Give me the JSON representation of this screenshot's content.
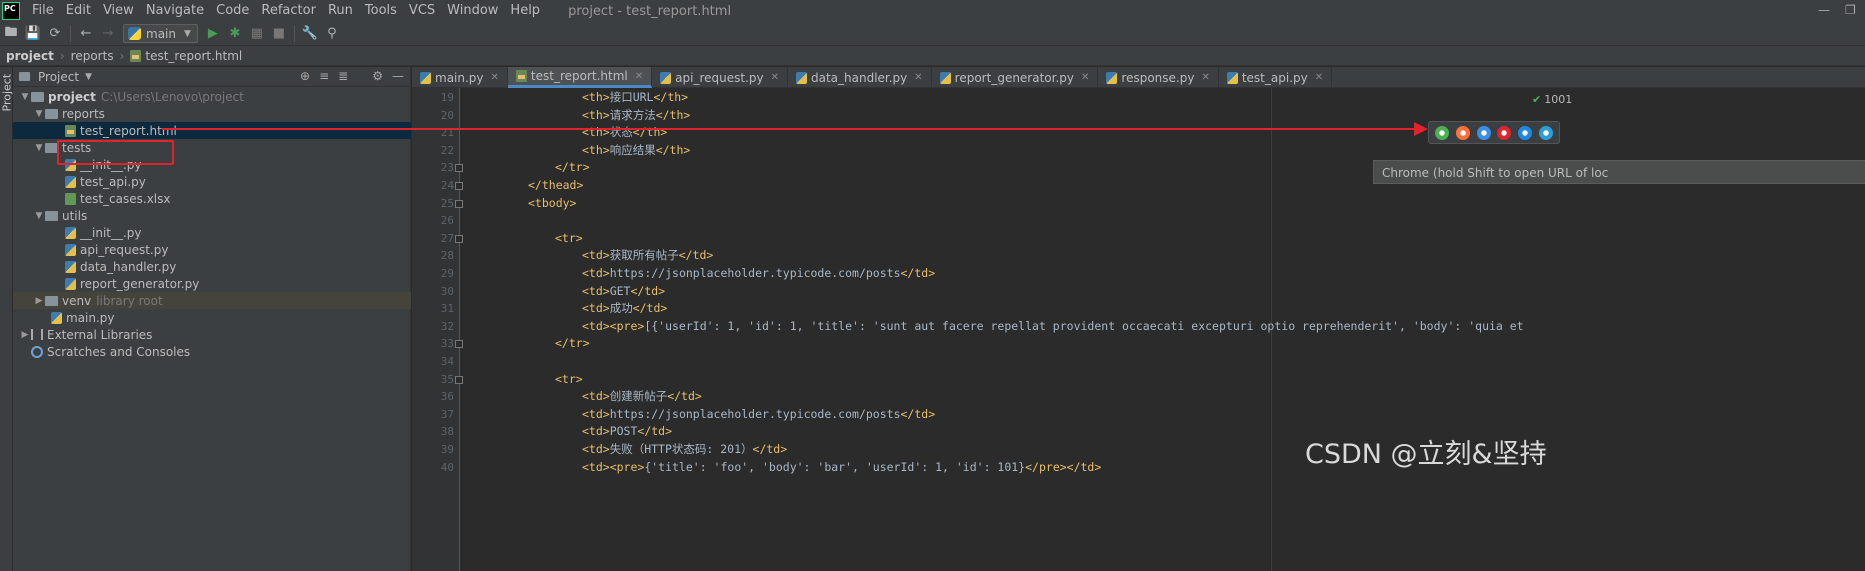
{
  "menubar": {
    "logo": "PC",
    "items": [
      "File",
      "Edit",
      "View",
      "Navigate",
      "Code",
      "Refactor",
      "Run",
      "Tools",
      "VCS",
      "Window",
      "Help"
    ],
    "window_title": "project - test_report.html"
  },
  "toolbar": {
    "run_config": "main"
  },
  "breadcrumb": [
    "project",
    "reports",
    "test_report.html"
  ],
  "side_strip": {
    "label": "Project"
  },
  "project_panel": {
    "title": "Project",
    "tree": {
      "root": {
        "name": "project",
        "path": "C:\\Users\\Lenovo\\project"
      },
      "reports": {
        "name": "reports",
        "file": "test_report.html"
      },
      "tests": {
        "name": "tests",
        "files": [
          "__init__.py",
          "test_api.py",
          "test_cases.xlsx"
        ]
      },
      "utils": {
        "name": "utils",
        "files": [
          "__init__.py",
          "api_request.py",
          "data_handler.py",
          "report_generator.py"
        ]
      },
      "venv": {
        "name": "venv",
        "hint": "library root"
      },
      "main": "main.py",
      "external": "External Libraries",
      "scratches": "Scratches and Consoles"
    }
  },
  "tabs": [
    "main.py",
    "test_report.html",
    "api_request.py",
    "data_handler.py",
    "report_generator.py",
    "response.py",
    "test_api.py"
  ],
  "editor": {
    "lines": [
      {
        "n": "19",
        "parts": [
          [
            "tag",
            "<th>"
          ],
          [
            "txt",
            "接口URL"
          ],
          [
            "tag",
            "</th>"
          ]
        ]
      },
      {
        "n": "20",
        "parts": [
          [
            "tag",
            "<th>"
          ],
          [
            "txt",
            "请求方法"
          ],
          [
            "tag",
            "</th>"
          ]
        ]
      },
      {
        "n": "21",
        "parts": [
          [
            "tag",
            "<th>"
          ],
          [
            "txt",
            "状态"
          ],
          [
            "tag",
            "</th>"
          ]
        ]
      },
      {
        "n": "22",
        "parts": [
          [
            "tag",
            "<th>"
          ],
          [
            "txt",
            "响应结果"
          ],
          [
            "tag",
            "</th>"
          ]
        ]
      },
      {
        "n": "23",
        "parts": [
          [
            "tag",
            "</tr>"
          ]
        ]
      },
      {
        "n": "24",
        "parts": [
          [
            "tag",
            "</thead>"
          ]
        ]
      },
      {
        "n": "25",
        "parts": [
          [
            "tag",
            "<tbody>"
          ]
        ]
      },
      {
        "n": "26",
        "parts": []
      },
      {
        "n": "27",
        "parts": [
          [
            "tag",
            "<tr>"
          ]
        ]
      },
      {
        "n": "28",
        "parts": [
          [
            "tag",
            "<td>"
          ],
          [
            "txt",
            "获取所有帖子"
          ],
          [
            "tag",
            "</td>"
          ]
        ]
      },
      {
        "n": "29",
        "parts": [
          [
            "tag",
            "<td>"
          ],
          [
            "txt",
            "https://jsonplaceholder.typicode.com/posts"
          ],
          [
            "tag",
            "</td>"
          ]
        ]
      },
      {
        "n": "30",
        "parts": [
          [
            "tag",
            "<td>"
          ],
          [
            "txt",
            "GET"
          ],
          [
            "tag",
            "</td>"
          ]
        ]
      },
      {
        "n": "31",
        "parts": [
          [
            "tag",
            "<td>"
          ],
          [
            "txt",
            "成功"
          ],
          [
            "tag",
            "</td>"
          ]
        ]
      },
      {
        "n": "32",
        "parts": [
          [
            "tag",
            "<td><pre>"
          ],
          [
            "txt",
            "[{'userId': 1, 'id': 1, 'title': 'sunt aut facere repellat provident occaecati excepturi optio reprehenderit', 'body': 'quia et"
          ]
        ]
      },
      {
        "n": "33",
        "parts": [
          [
            "tag",
            "</tr>"
          ]
        ]
      },
      {
        "n": "34",
        "parts": []
      },
      {
        "n": "35",
        "parts": [
          [
            "tag",
            "<tr>"
          ]
        ]
      },
      {
        "n": "36",
        "parts": [
          [
            "tag",
            "<td>"
          ],
          [
            "txt",
            "创建新帖子"
          ],
          [
            "tag",
            "</td>"
          ]
        ]
      },
      {
        "n": "37",
        "parts": [
          [
            "tag",
            "<td>"
          ],
          [
            "txt",
            "https://jsonplaceholder.typicode.com/posts"
          ],
          [
            "tag",
            "</td>"
          ]
        ]
      },
      {
        "n": "38",
        "parts": [
          [
            "tag",
            "<td>"
          ],
          [
            "txt",
            "POST"
          ],
          [
            "tag",
            "</td>"
          ]
        ]
      },
      {
        "n": "39",
        "parts": [
          [
            "tag",
            "<td>"
          ],
          [
            "txt",
            "失败（HTTP状态码: 201）"
          ],
          [
            "tag",
            "</td>"
          ]
        ]
      },
      {
        "n": "40",
        "parts": [
          [
            "tag",
            "<td><pre>"
          ],
          [
            "txt",
            "{'title': 'foo', 'body': 'bar', 'userId': 1, 'id': 101}"
          ],
          [
            "tag",
            "</pre></td>"
          ]
        ]
      }
    ],
    "indents": [
      4,
      4,
      4,
      4,
      3,
      2,
      2,
      0,
      3,
      4,
      4,
      4,
      4,
      4,
      3,
      0,
      3,
      4,
      4,
      4,
      4,
      4
    ]
  },
  "inspection_count": "1001",
  "tooltip": "Chrome (hold Shift to open URL of loc",
  "browser_icons": [
    "chrome-icon",
    "firefox-icon",
    "safari-icon",
    "opera-icon",
    "ie-icon",
    "edge-icon"
  ],
  "browser_colors": [
    "#4caf50",
    "#ff7139",
    "#3a8ee6",
    "#e0242b",
    "#1e88e5",
    "#2a9fd6"
  ],
  "watermark": "CSDN @立刻&坚持"
}
